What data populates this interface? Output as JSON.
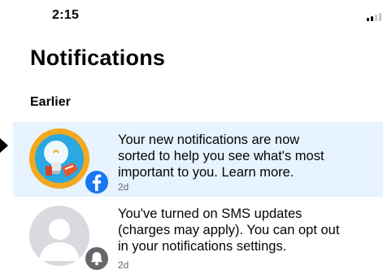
{
  "status_bar": {
    "time": "2:15"
  },
  "page": {
    "title": "Notifications"
  },
  "section": {
    "header": "Earlier"
  },
  "notifications": [
    {
      "lines": [
        "Your new notifications are now",
        "sorted to help you see what's most",
        "important to you. Learn more."
      ],
      "time": "2d",
      "badge_icon": "facebook-logo-icon",
      "avatar_icon": "lightbulb-icon",
      "unread": true
    },
    {
      "lines": [
        "You've turned on SMS updates",
        "(charges may apply). You can opt out",
        "in your notifications settings."
      ],
      "time": "2d",
      "badge_icon": "bell-icon",
      "avatar_icon": "default-profile-icon",
      "unread": false
    }
  ],
  "colors": {
    "unread_background": "#e7f3ff",
    "facebook_blue": "#1877f2",
    "secondary_text": "#65676b",
    "bell_badge": "#65676b"
  }
}
